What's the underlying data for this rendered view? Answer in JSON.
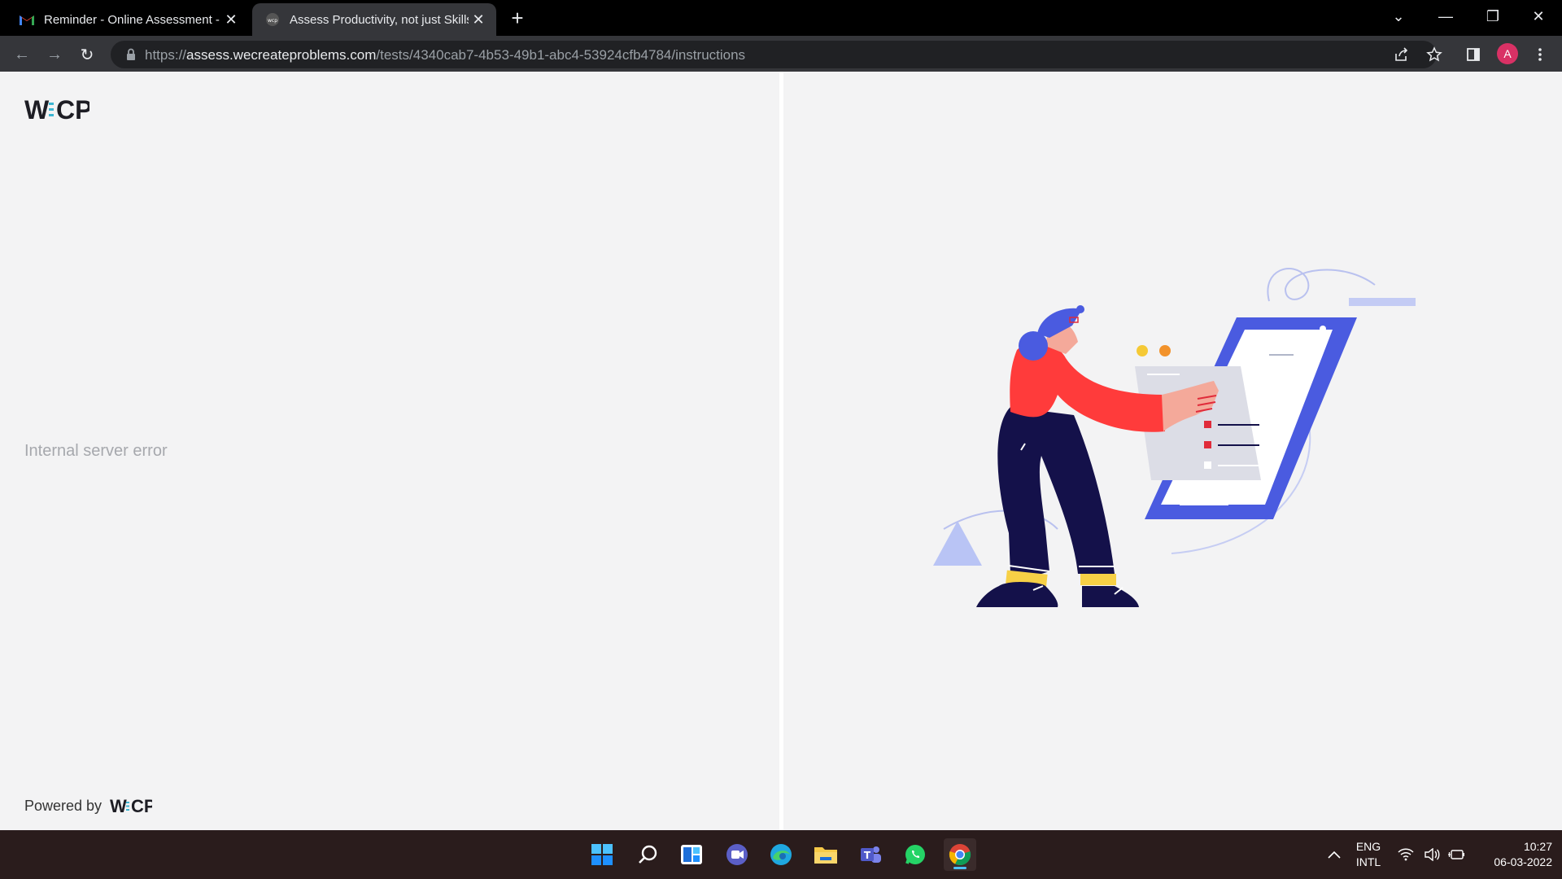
{
  "browser": {
    "tabs": [
      {
        "title": "Reminder - Online Assessment -",
        "icon": "gmail-icon"
      },
      {
        "title": "Assess Productivity, not just Skills",
        "icon": "wecp-favicon"
      }
    ],
    "url_scheme": "https://",
    "url_host": "assess.wecreateproblems.com",
    "url_path": "/tests/4340cab7-4b53-49b1-abc4-53924cfb4784/instructions",
    "profile_initial": "A"
  },
  "page": {
    "logo_text": "W:CP",
    "error_message": "Internal server error",
    "powered_by_label": "Powered by",
    "powered_logo_text": "W:CP"
  },
  "taskbar": {
    "apps": [
      "start-icon",
      "search-icon",
      "widgets-icon",
      "meet-icon",
      "edge-icon",
      "file-explorer-icon",
      "teams-icon",
      "whatsapp-icon",
      "chrome-icon"
    ],
    "active_app": "chrome-icon",
    "lang_line1": "ENG",
    "lang_line2": "INTL",
    "time": "10:27",
    "date": "06-03-2022"
  },
  "colors": {
    "accent_blue": "#4a5be0",
    "shirt_red": "#ff3b3b",
    "pants_navy": "#14114a",
    "shoe_yellow": "#f7d046"
  }
}
